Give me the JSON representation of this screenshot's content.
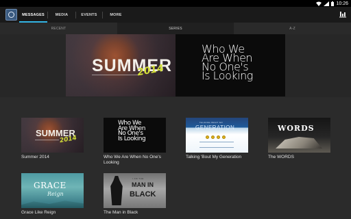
{
  "status_bar": {
    "time": "10:26",
    "icons": [
      "wifi-icon",
      "signal-icon",
      "battery-icon"
    ]
  },
  "app": {
    "logo_icon": "church-logo-icon",
    "accent": "#33b5e5",
    "tabs": [
      {
        "label": "MESSAGES",
        "active": true
      },
      {
        "label": "MEDIA",
        "active": false
      },
      {
        "label": "EVENTS",
        "active": false
      },
      {
        "label": "MORE",
        "active": false
      }
    ],
    "action_icon": "stats-icon"
  },
  "sub_tabs": [
    {
      "label": "RECENT",
      "active": false
    },
    {
      "label": "SERIES",
      "active": true
    },
    {
      "label": "A-Z",
      "active": false
    }
  ],
  "hero": {
    "items": [
      {
        "title": "SUMMER",
        "year": "2014"
      },
      {
        "lines": [
          "Who We",
          "Are When",
          "No One's",
          "Is Looking"
        ]
      }
    ]
  },
  "series": [
    {
      "title": "Summer 2014",
      "art_title": "SUMMER",
      "art_year": "2014"
    },
    {
      "title": "Who We Are When No One's Looking",
      "art_lines": [
        "Who We",
        "Are When",
        "No One's",
        "Is Looking"
      ]
    },
    {
      "title": "Talking 'Bout My Generation",
      "art_title": "GENERATION",
      "art_sub": "TALKING BOUT MY"
    },
    {
      "title": "The WORDS",
      "art_title": "WORDS"
    },
    {
      "title": "Grace Like Reign",
      "art_title": "GRACE",
      "art_sub": "Reign"
    },
    {
      "title": "The Man in Black",
      "art_small": "I AM THE",
      "art_title": "MAN IN",
      "art_sub": "BLACK"
    }
  ]
}
